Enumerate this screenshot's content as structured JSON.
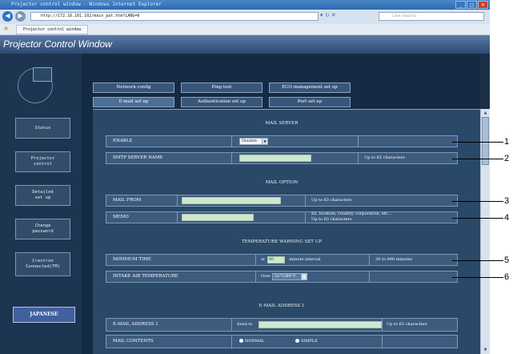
{
  "browser": {
    "title": "Projector control window - Windows Internet Explorer",
    "address": "http://172.16.101.102/main_pat.htm?LANG=0",
    "search_placeholder": "Live Search",
    "favorites_tab": "Projector control window"
  },
  "app": {
    "title": "Projector Control Window"
  },
  "sidebar": {
    "items": [
      {
        "label": "Status"
      },
      {
        "label": "Projector\ncontrol"
      },
      {
        "label": "Detailed\nset up"
      },
      {
        "label": "Change\npassword"
      },
      {
        "label": "Crestron\nConnected(TM)"
      }
    ],
    "language_button": "JAPANESE"
  },
  "tabs": {
    "row1": [
      "Network config",
      "Ping test",
      "ECO management set up"
    ],
    "row2": [
      "E-mail set up",
      "Authentication set up",
      "Port set up"
    ]
  },
  "mail_server": {
    "heading": "MAIL SERVER",
    "enable_label": "ENABLE",
    "enable_value": "Disable",
    "smtp_label": "SMTP SERVER NAME",
    "smtp_hint": "Up to 63 characters"
  },
  "mail_option": {
    "heading": "MAIL OPTION",
    "from_label": "MAIL FROM",
    "from_hint": "Up to 63 characters",
    "memo_label": "MEMO",
    "memo_hint1": "Ex. location, country, corporation, etc...",
    "memo_hint2": "Up to 63 characters"
  },
  "temp_warning": {
    "heading": "TEMPERATURE WARNING SET UP",
    "min_label": "MINIMUM TIME",
    "min_prefix": "at",
    "min_value": "60",
    "min_suffix": "-minute interval",
    "min_range": "30 to 999 minutes",
    "intake_label": "INTAKE AIR TEMPERATURE",
    "intake_prefix": "Over",
    "intake_value": "32°C/89°F"
  },
  "email1": {
    "heading": "E-MAIL ADDRESS 1",
    "addr_label": "E-MAIL ADDRESS 1",
    "send_prefix": "Send to",
    "addr_hint": "Up to 63 characters",
    "contents_label": "MAIL CONTENTS",
    "opt_normal": "NORMAL",
    "opt_simple": "SIMPLE"
  },
  "callouts": [
    "1",
    "2",
    "3",
    "4",
    "5",
    "6"
  ]
}
